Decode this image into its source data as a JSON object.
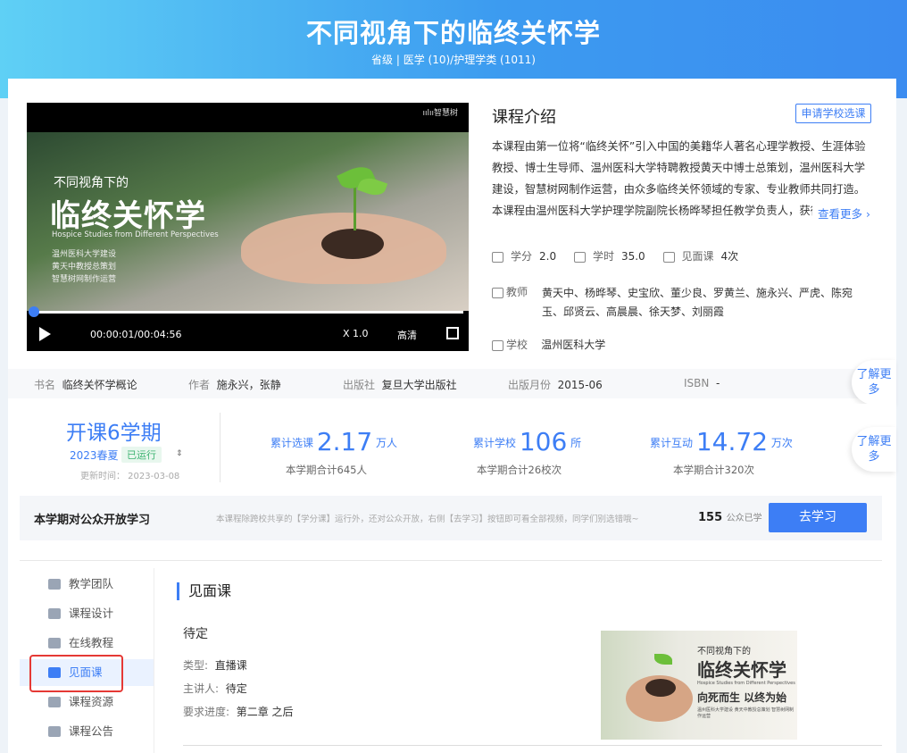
{
  "header": {
    "title": "不同视角下的临终关怀学",
    "subtitle": "省级 | 医学 (10)/护理学类 (1011)"
  },
  "video": {
    "brand": "ıılıı智慧树",
    "line1": "不同视角下的",
    "line2": "临终关怀学",
    "line3": "Hospice Studies from Different Perspectives",
    "line4": "温州医科大学建设",
    "line5": "黄天中教授总策划",
    "line6": "智慧树网制作运营",
    "time": "00:00:01/00:04:56",
    "speed": "X 1.0",
    "quality": "高清"
  },
  "intro": {
    "title": "课程介绍",
    "apply": "申请学校选课",
    "text": "本课程由第一位将“临终关怀”引入中国的美籍华人著名心理学教授、生涯体验教授、博士生导师、温州医科大学特聘教授黄天中博士总策划，温州医科大学建设，智慧树网制作运营，由众多临终关怀领域的专家、专业教师共同打造。本课程由温州医科大学护理学院副院长杨晔琴担任教学负责人，获得浙江省第",
    "more": "查看更多 ›"
  },
  "meta": {
    "credit_label": "学分",
    "credit": "2.0",
    "hours_label": "学时",
    "hours": "35.0",
    "meet_label": "见面课",
    "meet": "4次",
    "teacher_label": "教师",
    "teachers": "黄天中、杨晔琴、史宝欣、董少良、罗黄兰、施永兴、严虎、陈宛玉、邱贤云、高晨晨、徐天梦、刘丽霞",
    "school_label": "学校",
    "school": "温州医科大学"
  },
  "book": {
    "name_label": "书名",
    "name": "临终关怀学概论",
    "author_label": "作者",
    "author": "施永兴，张静",
    "publisher_label": "出版社",
    "publisher": "复旦大学出版社",
    "month_label": "出版月份",
    "month": "2015-06",
    "isbn_label": "ISBN",
    "isbn": "-",
    "learn_more": "了解更多"
  },
  "stats": {
    "open": "开课6学期",
    "term": "2023春夏",
    "status": "已运行",
    "updated": "更新时间：  2023-03-08",
    "s1_label": "累计选课",
    "s1": "2.17",
    "s1_unit": "万人",
    "s1_sub": "本学期合计645人",
    "s2_label": "累计学校",
    "s2": "106",
    "s2_unit": "所",
    "s2_sub": "本学期合计26校次",
    "s3_label": "累计互动",
    "s3": "14.72",
    "s3_unit": "万次",
    "s3_sub": "本学期合计320次",
    "learn_more": "了解更多"
  },
  "public": {
    "title": "本学期对公众开放学习",
    "desc": "本课程除跨校共享的【学分课】运行外，还对公众开放，右侧【去学习】按钮即可看全部视频，同学们别选错哦~",
    "count": "155",
    "count_unit": "公众已学",
    "button": "去学习"
  },
  "sidebar": {
    "items": [
      "教学团队",
      "课程设计",
      "在线教程",
      "见面课",
      "课程资源",
      "课程公告"
    ]
  },
  "section": {
    "title": "见面课",
    "status": "待定",
    "type_label": "类型:",
    "type": "直播课",
    "speaker_label": "主讲人:",
    "speaker": "待定",
    "progress_label": "要求进度:",
    "progress": "第二章 之后"
  },
  "poster": {
    "t1": "不同视角下的",
    "t2": "临终关怀学",
    "t3": "Hospice Studies from Different Perspectives",
    "t4": "向死而生 以终为始",
    "t5": "温州医科大学建设 黄天中教授总策划 智慧树网制作运营"
  }
}
